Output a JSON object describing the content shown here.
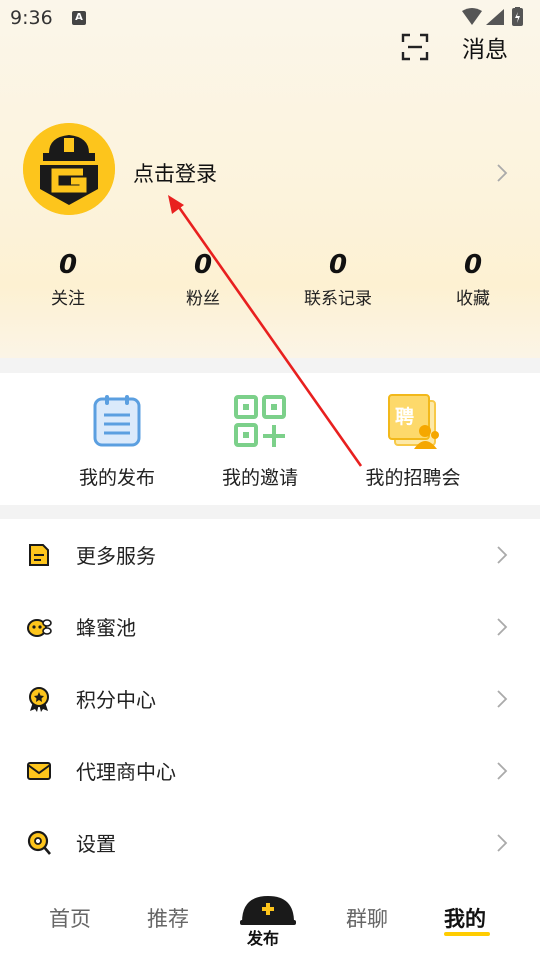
{
  "status": {
    "time": "9:36",
    "sim": "A"
  },
  "header": {
    "messages_label": "消息"
  },
  "profile": {
    "login_label": "点击登录"
  },
  "stats": [
    {
      "value": "0",
      "label": "关注"
    },
    {
      "value": "0",
      "label": "粉丝"
    },
    {
      "value": "0",
      "label": "联系记录"
    },
    {
      "value": "0",
      "label": "收藏"
    }
  ],
  "quick_actions": [
    {
      "label": "我的发布",
      "icon": "clipboard-icon"
    },
    {
      "label": "我的邀请",
      "icon": "qr-code-icon"
    },
    {
      "label": "我的招聘会",
      "icon": "job-fair-icon",
      "badge_char": "聘"
    }
  ],
  "menu": [
    {
      "label": "更多服务",
      "icon": "document-icon"
    },
    {
      "label": "蜂蜜池",
      "icon": "bee-icon"
    },
    {
      "label": "积分中心",
      "icon": "medal-icon"
    },
    {
      "label": "代理商中心",
      "icon": "envelope-icon"
    },
    {
      "label": "设置",
      "icon": "settings-icon"
    }
  ],
  "nav": {
    "home": "首页",
    "recommend": "推荐",
    "publish": "发布",
    "group_chat": "群聊",
    "mine": "我的"
  },
  "colors": {
    "accent": "#fdc51c",
    "arrow": "#e8201f",
    "blue_icon": "#5b9fe0",
    "green_icon": "#7cd08a"
  }
}
